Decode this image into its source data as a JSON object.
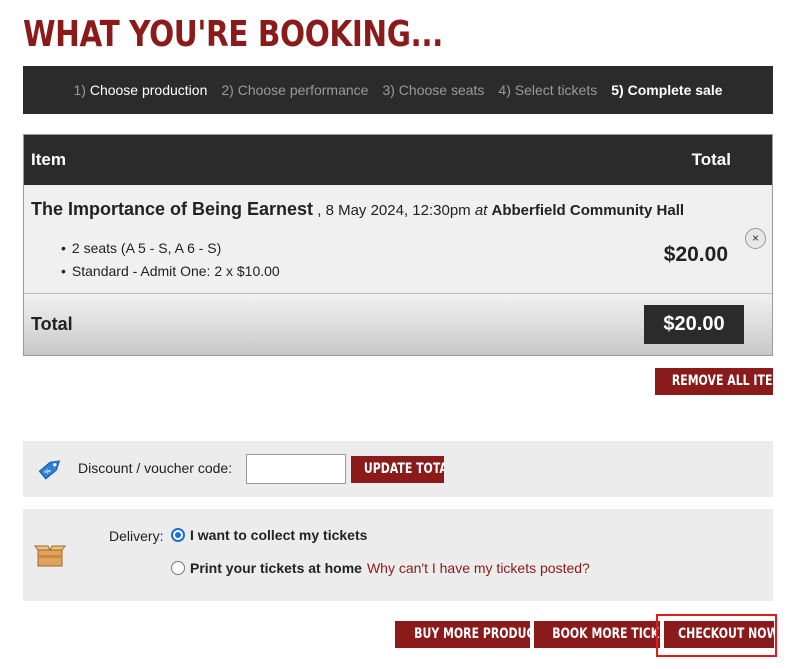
{
  "page": {
    "title": "WHAT YOU'RE BOOKING..."
  },
  "steps": [
    {
      "num": "1)",
      "label": "Choose production"
    },
    {
      "num": "2)",
      "label": "Choose performance"
    },
    {
      "num": "3)",
      "label": "Choose seats"
    },
    {
      "num": "4)",
      "label": "Select tickets"
    },
    {
      "num": "5)",
      "label": "Complete sale"
    }
  ],
  "basket": {
    "col_item": "Item",
    "col_total": "Total",
    "item": {
      "show": "The Importance of Being Earnest",
      "date_text": " , 8 May 2024, 12:30pm ",
      "at": "at",
      "venue": "Abberfield Community Hall",
      "lines": [
        "2 seats (A 5 - S, A 6 - S)",
        "Standard - Admit One: 2 x $10.00"
      ],
      "price": "$20.00",
      "remove_symbol": "×"
    },
    "total_label": "Total",
    "total_value": "$20.00"
  },
  "buttons": {
    "remove_all": "REMOVE ALL ITEMS",
    "update_total": "UPDATE TOTAL",
    "buy_more": "BUY MORE PRODUCTS",
    "book_more": "BOOK MORE TICKETS",
    "checkout": "CHECKOUT NOW"
  },
  "discount": {
    "label": "Discount / voucher code:",
    "value": "",
    "icon": "discount-tag-icon"
  },
  "delivery": {
    "label": "Delivery:",
    "icon": "package-box-icon",
    "options": [
      {
        "label": "I want to collect my tickets",
        "checked": true
      },
      {
        "label": "Print your tickets at home",
        "checked": false
      }
    ],
    "posted_link": "Why can't I have my tickets posted?"
  },
  "colors": {
    "brand": "#8b1a1a",
    "dark_bar": "#2b2b2b",
    "highlight": "#e31b1b",
    "radio": "#1a6ed8"
  }
}
